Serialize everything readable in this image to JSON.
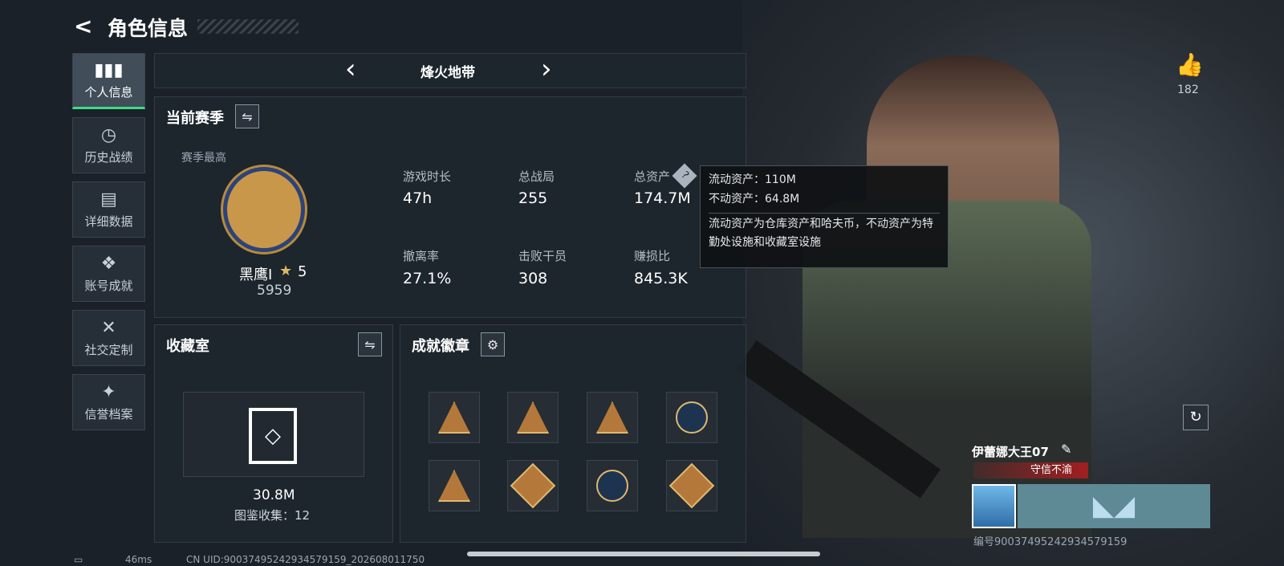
{
  "page": {
    "title": "角色信息"
  },
  "nav": [
    {
      "icon": "▮▮▮",
      "label": "个人信息"
    },
    {
      "icon": "◷",
      "label": "历史战绩"
    },
    {
      "icon": "▤",
      "label": "详细数据"
    },
    {
      "icon": "❖",
      "label": "账号成就"
    },
    {
      "icon": "✕",
      "label": "社交定制"
    },
    {
      "icon": "✦",
      "label": "信誉档案"
    }
  ],
  "mode": {
    "name": "烽火地带",
    "prev": "‹",
    "next": "›"
  },
  "season": {
    "title": "当前赛季",
    "best": "赛季最高",
    "rank": "黑鹰Ⅰ",
    "stars": "5",
    "score": "5959"
  },
  "stats": [
    {
      "label": "游戏时长",
      "value": "47h"
    },
    {
      "label": "总战局",
      "value": "255"
    },
    {
      "label": "总资产",
      "value": "174.7M"
    },
    {
      "label": "撤离率",
      "value": "27.1%"
    },
    {
      "label": "击败干员",
      "value": "308"
    },
    {
      "label": "赚损比",
      "value": "845.3K"
    }
  ],
  "tooltip": {
    "l1": "流动资产：110M",
    "l2": "不动资产：64.8M",
    "desc": "流动资产为仓库资产和哈夫币，不动资产为特勤处设施和收藏室设施"
  },
  "collection": {
    "title": "收藏室",
    "value": "30.8M",
    "count": "图鉴收集：12"
  },
  "achieve": {
    "title": "成就徽章"
  },
  "likes": {
    "count": "182"
  },
  "player": {
    "name": "伊蕾娜大王07",
    "title": "守信不渝",
    "id": "编号9003749524293457915​9"
  },
  "footer": {
    "ping": "46ms",
    "uid": "CN UID:90037495242934579159_202608011750"
  },
  "colors": {
    "accent": "#3ddc84",
    "title_bar": "#a11f1f"
  }
}
